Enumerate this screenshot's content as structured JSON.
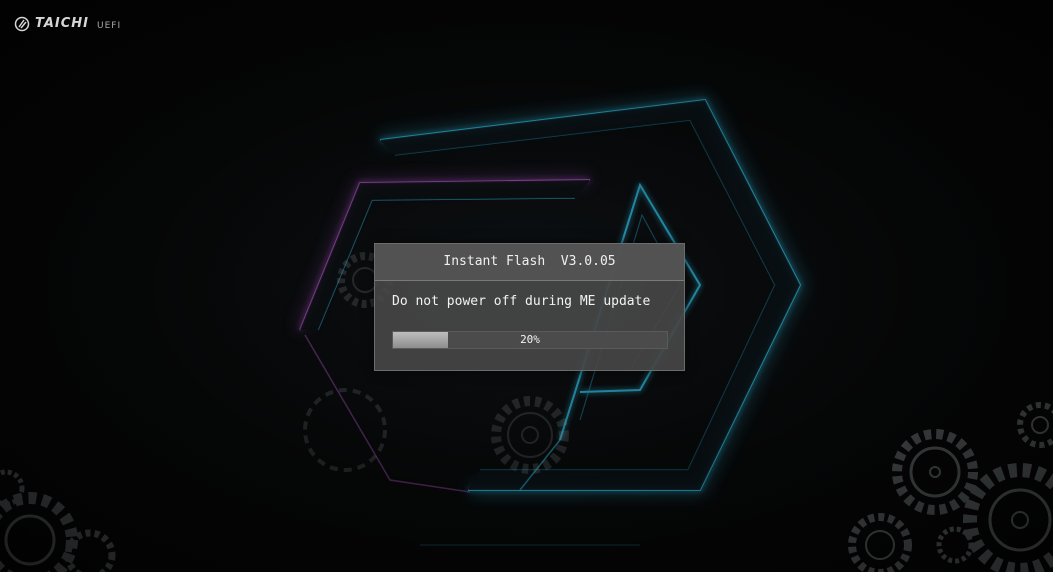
{
  "brand": {
    "name": "TAICHI",
    "subtitle": "UEFI",
    "emblem_icon": "taichi-emblem-icon"
  },
  "dialog": {
    "title": "Instant Flash  V3.0.05",
    "message": "Do not power off during ME update",
    "progress": {
      "percent": 20,
      "label": "20%"
    }
  },
  "colors": {
    "glow_cyan": "#2fb4d6",
    "glow_magenta": "#a04fb8",
    "dialog_bg": "#464646",
    "progress_fill": "#a8a8a8"
  },
  "background": {
    "logo_icon": "taichi-chevron-logo-icon",
    "decor_icons": [
      "gear-icon"
    ]
  }
}
